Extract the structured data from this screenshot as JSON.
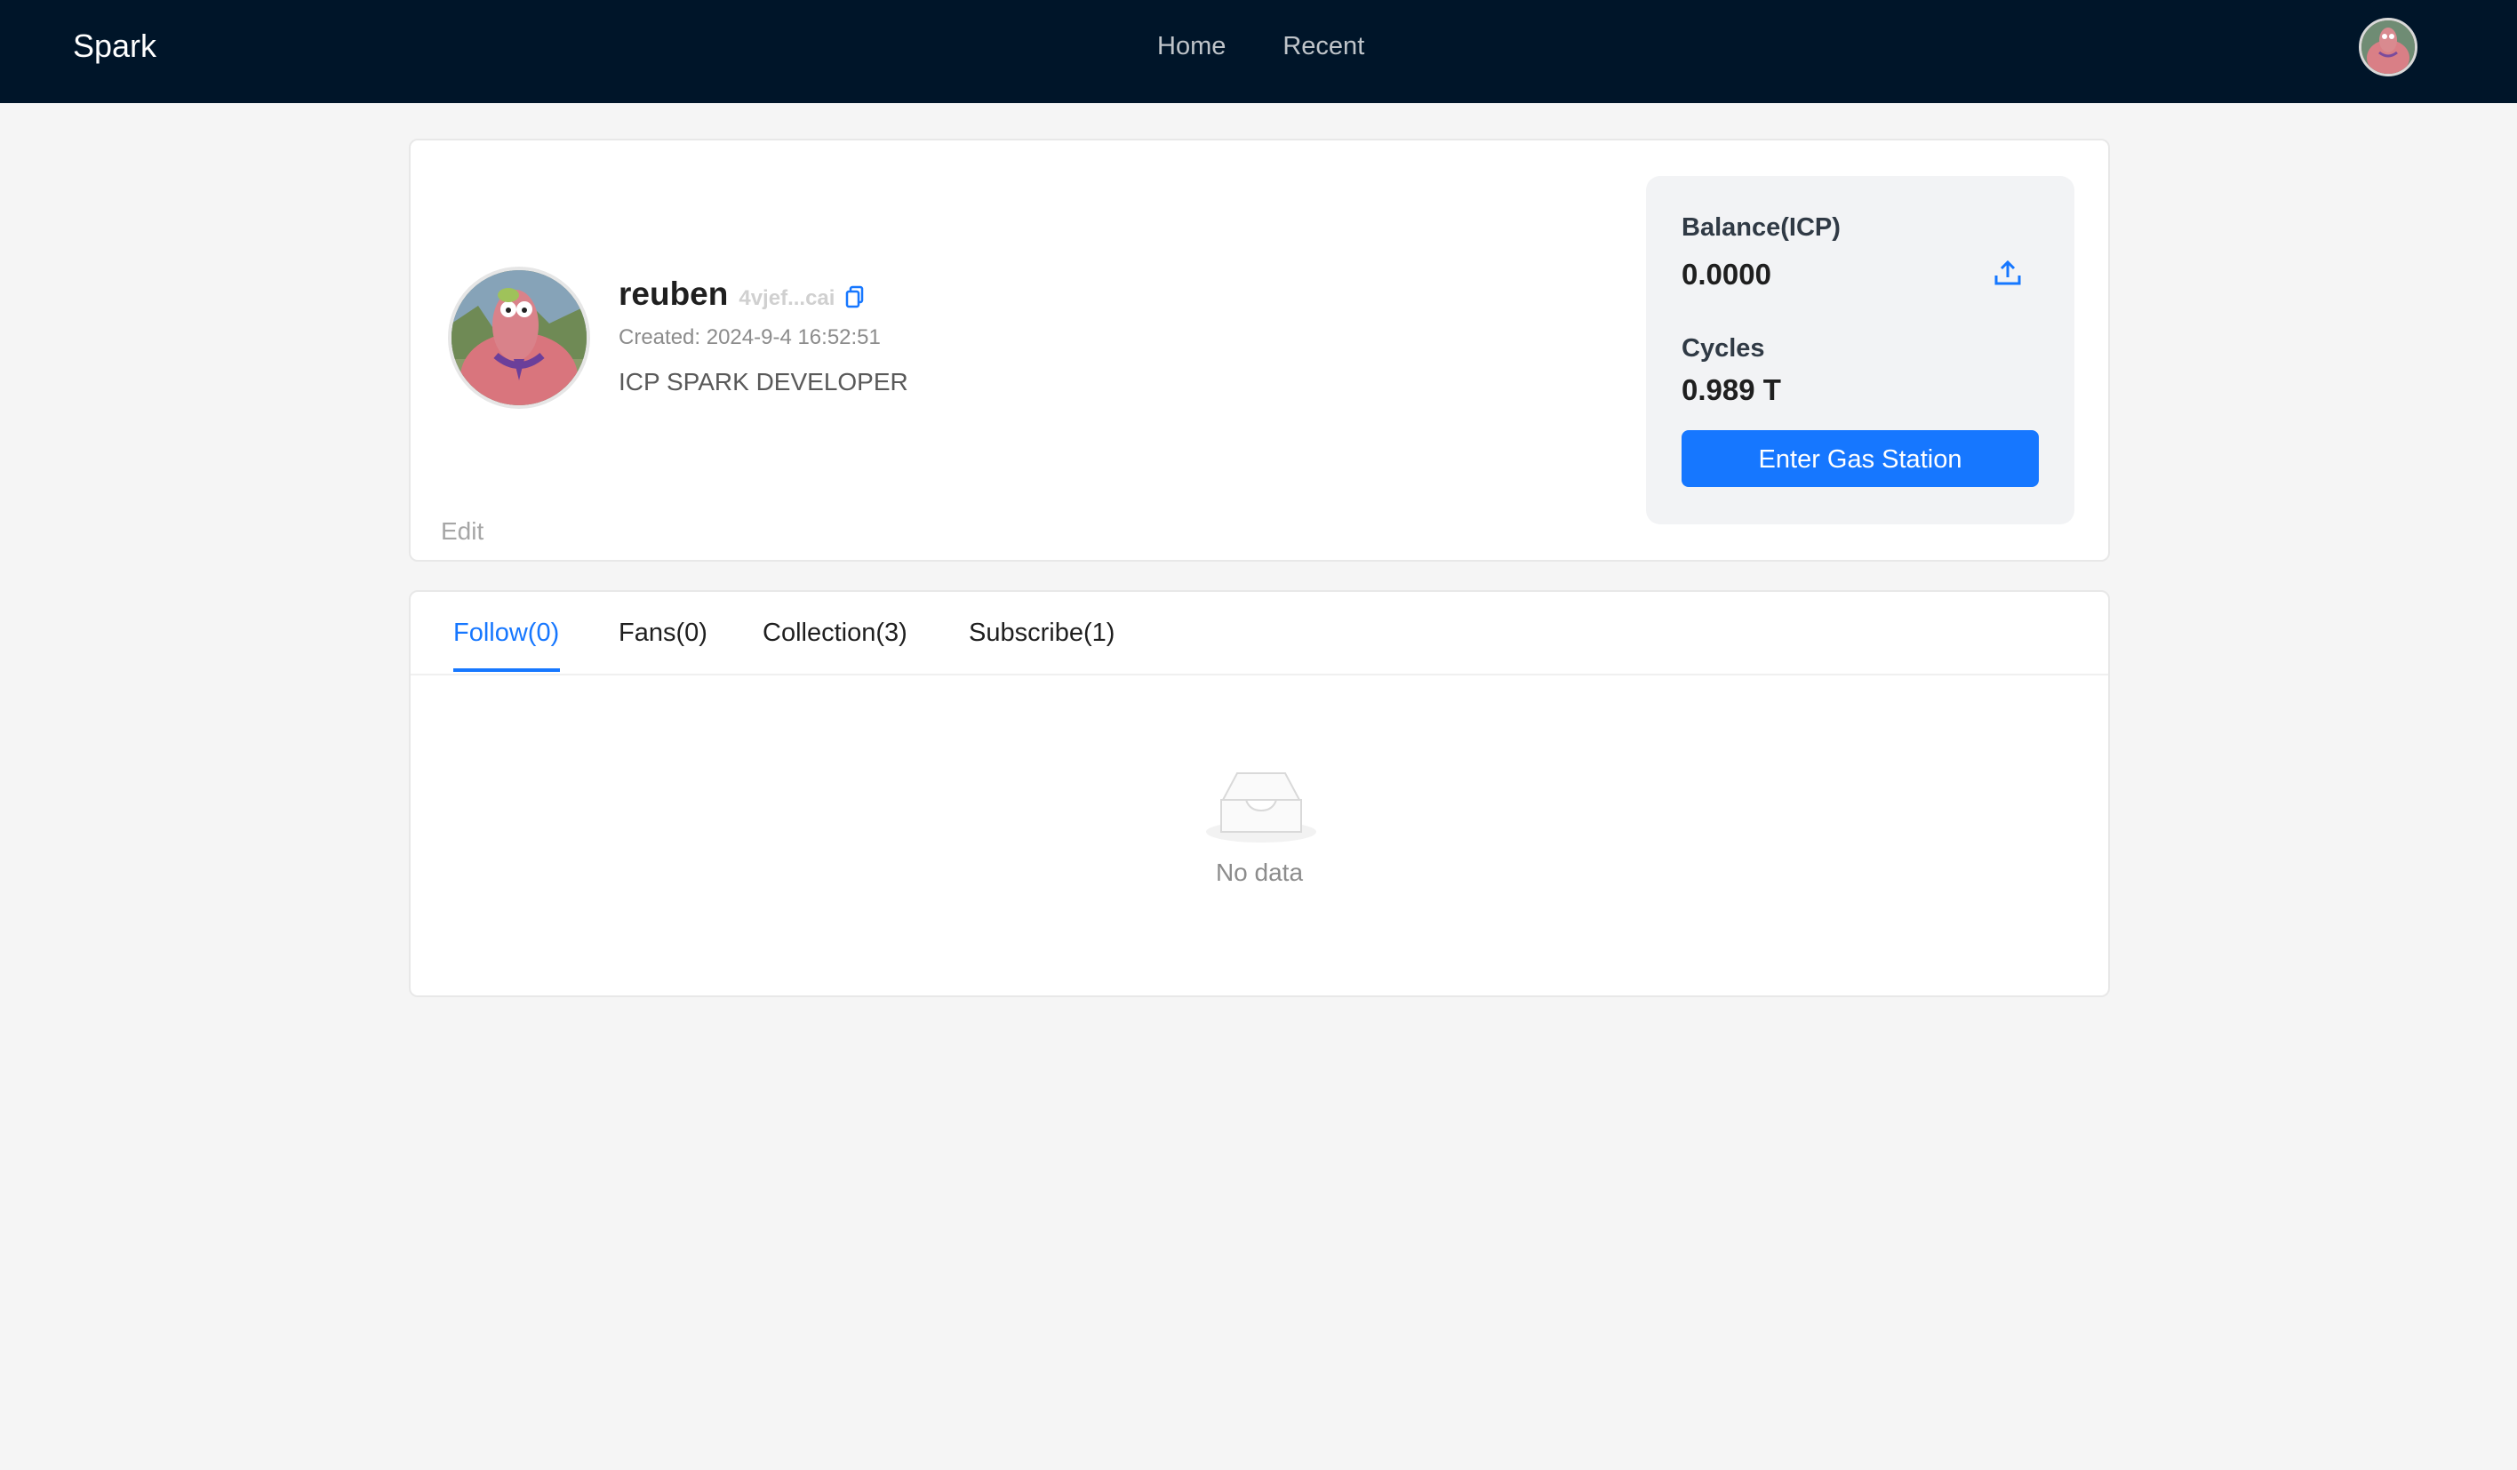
{
  "header": {
    "brand": "Spark",
    "nav": [
      "Home",
      "Recent"
    ]
  },
  "profile": {
    "username": "reuben",
    "principal": "4vjef...cai",
    "created": "Created: 2024-9-4 16:52:51",
    "bio": "ICP SPARK DEVELOPER",
    "edit_label": "Edit"
  },
  "wallet": {
    "balance_label": "Balance(ICP)",
    "balance_value": "0.0000",
    "cycles_label": "Cycles",
    "cycles_value": "0.989 T",
    "gas_button": "Enter Gas Station"
  },
  "tabs": [
    {
      "label": "Follow(0)",
      "active": true
    },
    {
      "label": "Fans(0)",
      "active": false
    },
    {
      "label": "Collection(3)",
      "active": false
    },
    {
      "label": "Subscribe(1)",
      "active": false
    }
  ],
  "empty_state": {
    "text": "No data"
  },
  "colors": {
    "header_bg": "#001529",
    "accent": "#1677ff",
    "page_bg": "#f5f5f5"
  }
}
